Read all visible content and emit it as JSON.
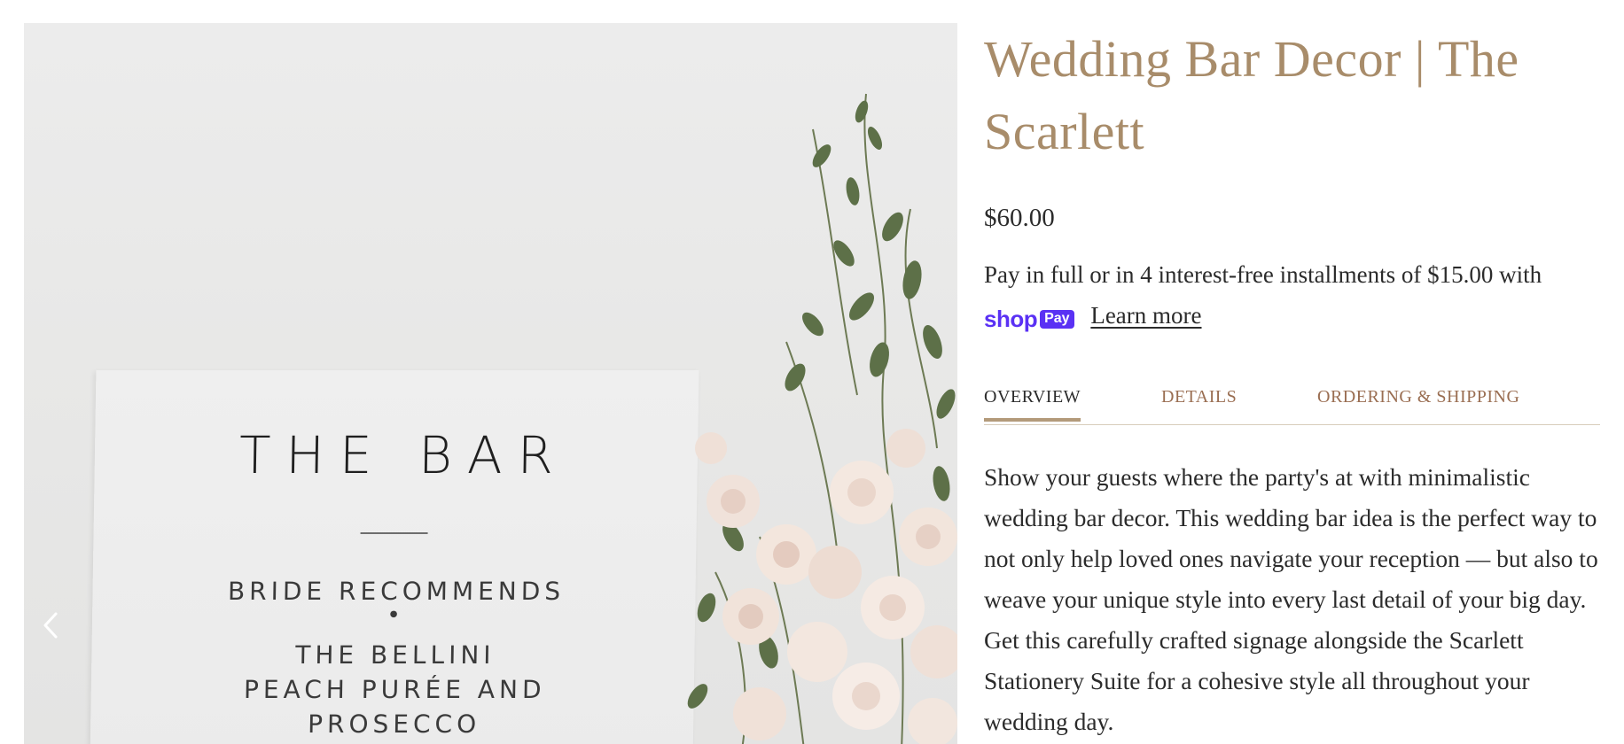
{
  "gallery": {
    "prev_icon": "chevron-left-icon",
    "image": {
      "sign_title": "THE BAR",
      "line1": "BRIDE RECOMMENDS",
      "dot": "•",
      "line2": "THE BELLINI",
      "line3": "PEACH PURÉE AND",
      "line4": "PROSECCO"
    }
  },
  "product": {
    "title": "Wedding Bar Decor | The Scarlett",
    "price": "$60.00",
    "installments_text": "Pay in full or in 4 interest-free installments of $15.00 with",
    "shop_pay": {
      "shop_word": "shop",
      "pay_word": "Pay",
      "brand_color": "#5a31f4"
    },
    "learn_more": "Learn more"
  },
  "tabs": [
    {
      "label": "OVERVIEW",
      "active": true
    },
    {
      "label": "DETAILS",
      "active": false
    },
    {
      "label": "ORDERING & SHIPPING",
      "active": false
    }
  ],
  "overview": {
    "description": "Show your guests where the party's at with minimalistic wedding bar decor. This wedding bar idea is the perfect way to not only help loved ones navigate your reception  — but also to weave your unique style into every last detail of your big day. Get this carefully crafted signage alongside the Scarlett Stationery Suite for a cohesive style all throughout your wedding day."
  },
  "colors": {
    "title": "#a88c6a",
    "tab_inactive": "#9a6e52",
    "tab_underline": "#b39a7a",
    "body_text": "#2b2b2b"
  }
}
